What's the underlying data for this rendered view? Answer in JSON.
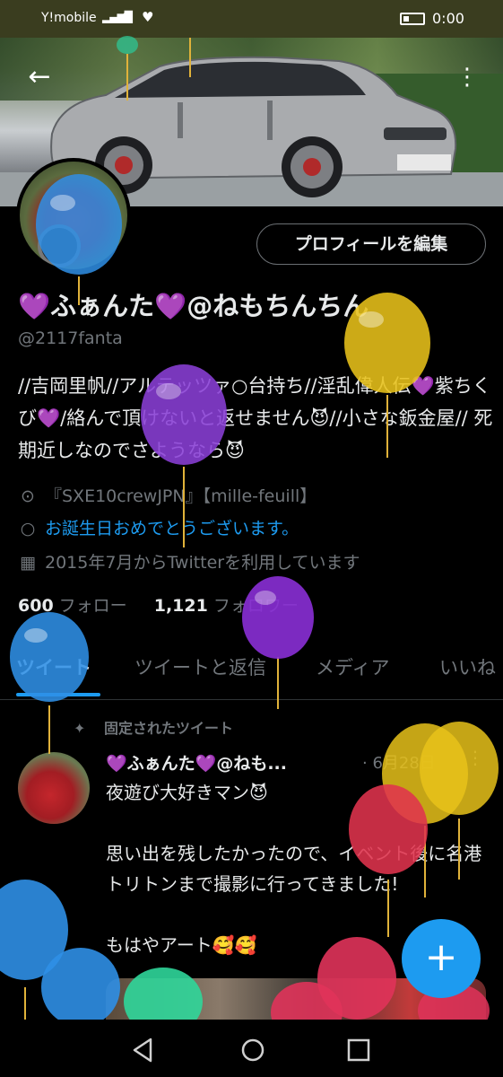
{
  "status_bar": {
    "carrier": "Y!mobile",
    "time": "0:00",
    "heart": "♥"
  },
  "header": {
    "back_icon": "←",
    "more_icon": "⋮"
  },
  "profile": {
    "edit_button": "プロフィールを編集",
    "name": "💜ふぁんた💜@ねもちんちん",
    "handle": "@2117fanta",
    "bio": "//吉岡里帆//アルテッツァ○台持ち//淫乱偉人伝💜紫ちくび💜/絡んで頂けないと返せません😈//小さな鈑金屋//  死期近しなのでさようなら😈",
    "location": "『SXE10crewJPN』【mille-feuill】",
    "birthday": "お誕生日おめでとうございます。",
    "joined": "2015年7月からTwitterを利用しています",
    "following_count": "600",
    "following_label": "フォロー",
    "followers_count": "1,121",
    "followers_label": "フォロワー"
  },
  "tabs": [
    {
      "label": "ツイート"
    },
    {
      "label": "ツイートと返信"
    },
    {
      "label": "メディア"
    },
    {
      "label": "いいね"
    }
  ],
  "tweet": {
    "pinned_label": "固定されたツイート",
    "author": "💜ふぁんた💜@ねも...",
    "date": "· 6月28日",
    "more": "⋮",
    "body": "夜遊び大好きマン😈\n\n思い出を残したかったので、イベント後に名港トリトンまで撮影に行ってきました!\n\nもはやアート🥰🥰"
  },
  "fab_label": "+",
  "colors": {
    "accent": "#1d9bf0",
    "background": "#000000",
    "text_primary": "#e7e9ea",
    "text_secondary": "#71767b",
    "status_bar": "#3a3d1f"
  },
  "icons": {
    "location": "location-pin-icon",
    "birthday": "balloon-icon",
    "joined": "calendar-icon",
    "pin": "pin-icon",
    "fab": "plus-icon"
  }
}
